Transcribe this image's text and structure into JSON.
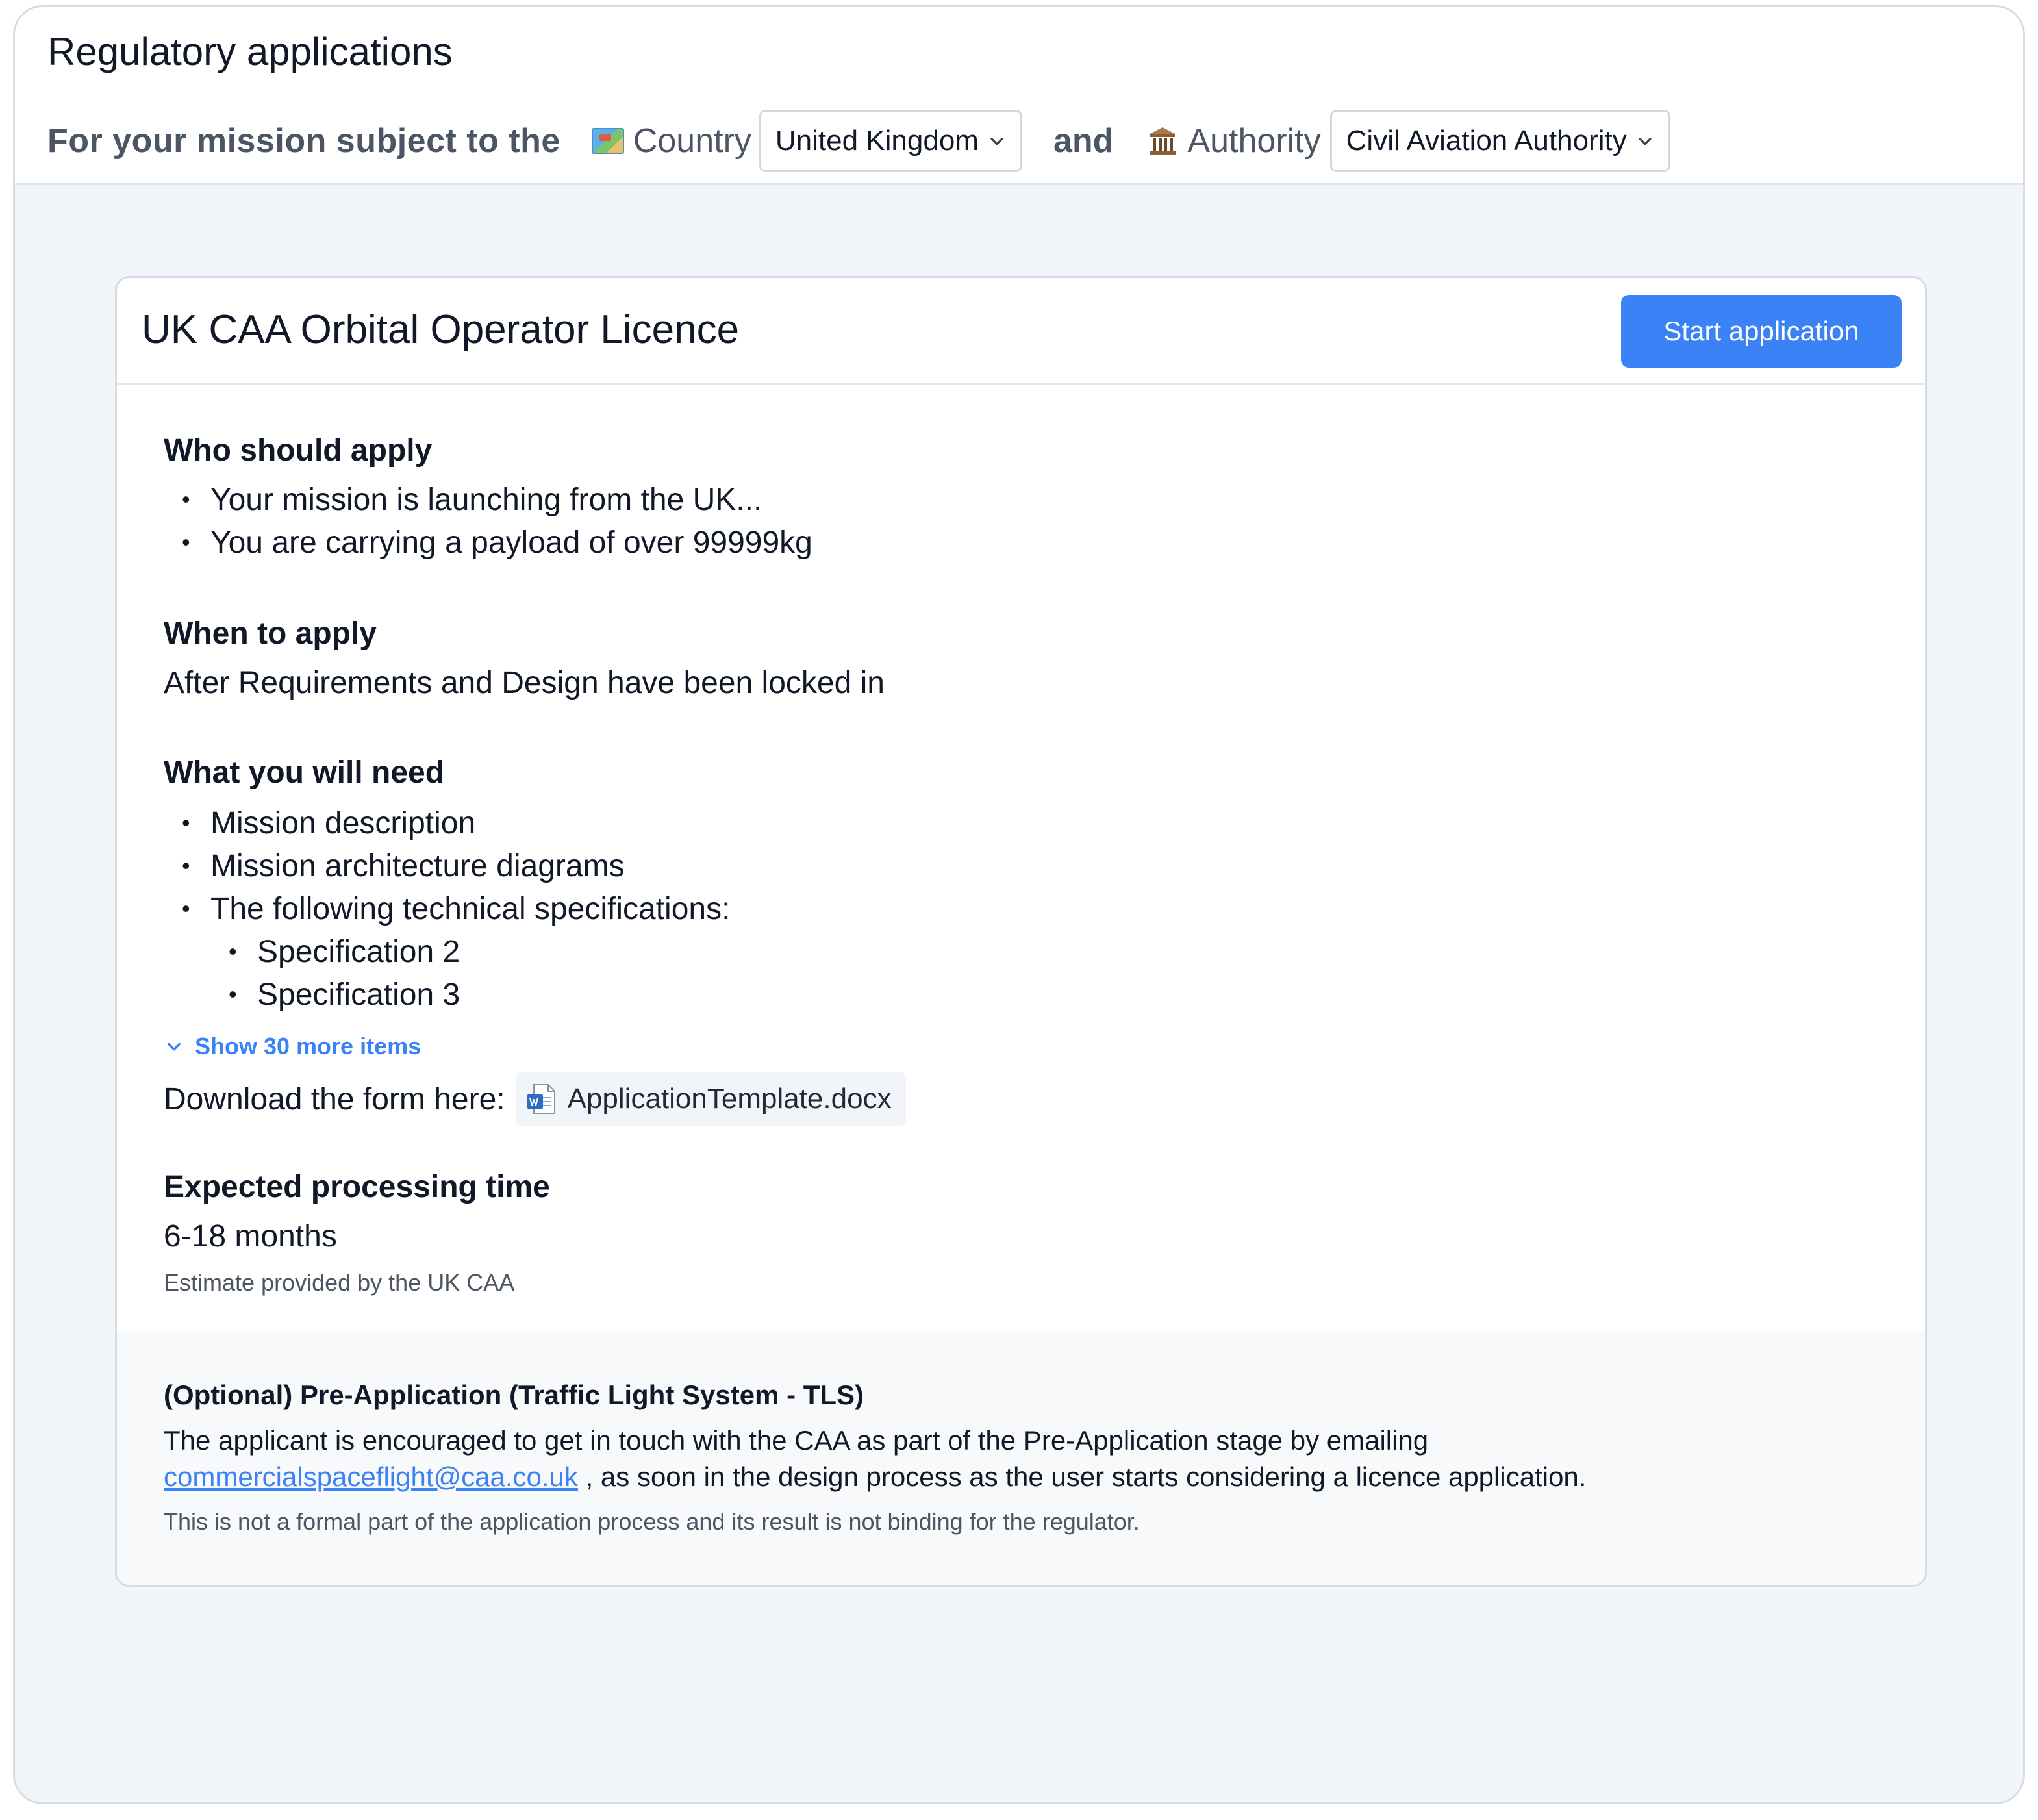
{
  "header": {
    "title": "Regulatory applications",
    "filter_lead": "For your mission subject to the",
    "country_label": "Country",
    "country_value": "United Kingdom",
    "and_text": "and",
    "authority_label": "Authority",
    "authority_value": "Civil Aviation Authority"
  },
  "card": {
    "title": "UK CAA Orbital Operator Licence",
    "start_button": "Start application",
    "who": {
      "heading": "Who should apply",
      "items": [
        "Your mission is launching from the UK...",
        "You are carrying a payload of over 99999kg"
      ]
    },
    "when": {
      "heading": "When to apply",
      "text": "After Requirements and Design have been locked in"
    },
    "need": {
      "heading": "What you will need",
      "items": [
        "Mission description",
        "Mission architecture diagrams",
        "The following technical specifications:"
      ],
      "sub_items": [
        "Specification 2",
        "Specification 3"
      ],
      "show_more": "Show 30 more items",
      "download_label": "Download the form here:",
      "file_name": "ApplicationTemplate.docx"
    },
    "processing": {
      "heading": "Expected processing time",
      "value": "6-18 months",
      "note": "Estimate provided by the UK CAA"
    },
    "pre_application": {
      "title": "(Optional) Pre-Application (Traffic Light System - TLS)",
      "line1": "The applicant is encouraged to get in touch with the CAA as part of the Pre-Application stage by emailing",
      "email": "commercialspaceflight@caa.co.uk",
      "line2_rest": " , as soon in the design process as the user starts considering a licence application.",
      "note": "This is not a formal part of the application process and its result is not binding for the regulator."
    }
  },
  "colors": {
    "accent": "#3b82f6",
    "page_bg": "#f1f4f8",
    "text": "#111827",
    "muted": "#4b5563"
  },
  "icons": {
    "country": "world-map-icon",
    "authority": "classical-building-icon",
    "dropdown": "chevron-down-icon",
    "show_more": "chevron-down-icon",
    "file": "word-document-icon"
  }
}
